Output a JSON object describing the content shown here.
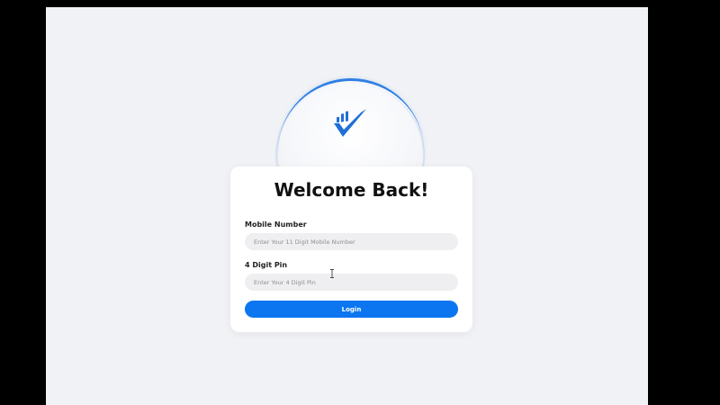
{
  "login": {
    "title": "Welcome Back!",
    "mobile": {
      "label": "Mobile Number",
      "placeholder": "Enter Your 11 Digit Mobile Number",
      "value": ""
    },
    "pin": {
      "label": "4 Digit Pin",
      "placeholder": "Enter Your 4 Digit Pin",
      "value": ""
    },
    "button_label": "Login"
  },
  "icons": {
    "logo": "checkmark-bars-logo-icon",
    "cursor": "text-cursor-icon"
  },
  "colors": {
    "accent": "#0b76f0",
    "logo_blue": "#1f6fd6",
    "background": "#f1f2f5",
    "card": "#ffffff",
    "input_bg": "#efeff1"
  }
}
